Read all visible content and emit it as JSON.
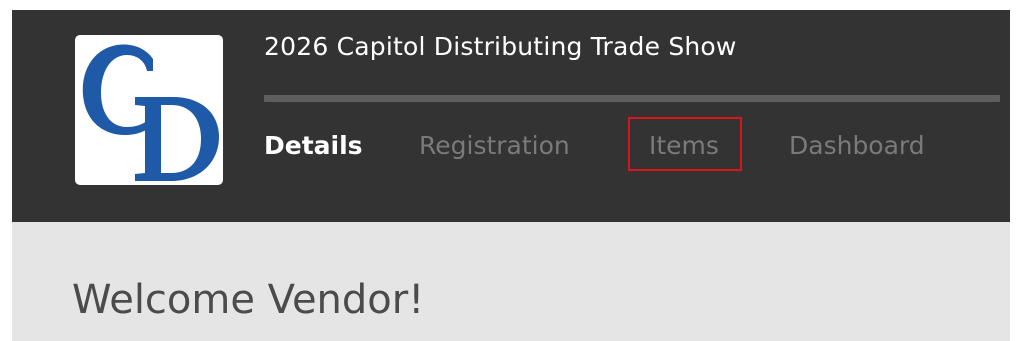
{
  "header": {
    "logo_text": "CD",
    "event_title": "2026 Capitol Distributing Trade Show",
    "progress": 0.0
  },
  "tabs": [
    {
      "label": "Details",
      "active": true
    },
    {
      "label": "Registration",
      "active": false
    },
    {
      "label": "Items",
      "active": false,
      "highlighted": true
    },
    {
      "label": "Dashboard",
      "active": false
    }
  ],
  "main": {
    "heading": "Welcome Vendor!"
  },
  "colors": {
    "header_bg": "#333333",
    "content_bg": "#e5e5e5",
    "logo_blue": "#1f5aa8",
    "highlight": "#d8161c"
  },
  "icons": {
    "logo": "cd-logo"
  }
}
